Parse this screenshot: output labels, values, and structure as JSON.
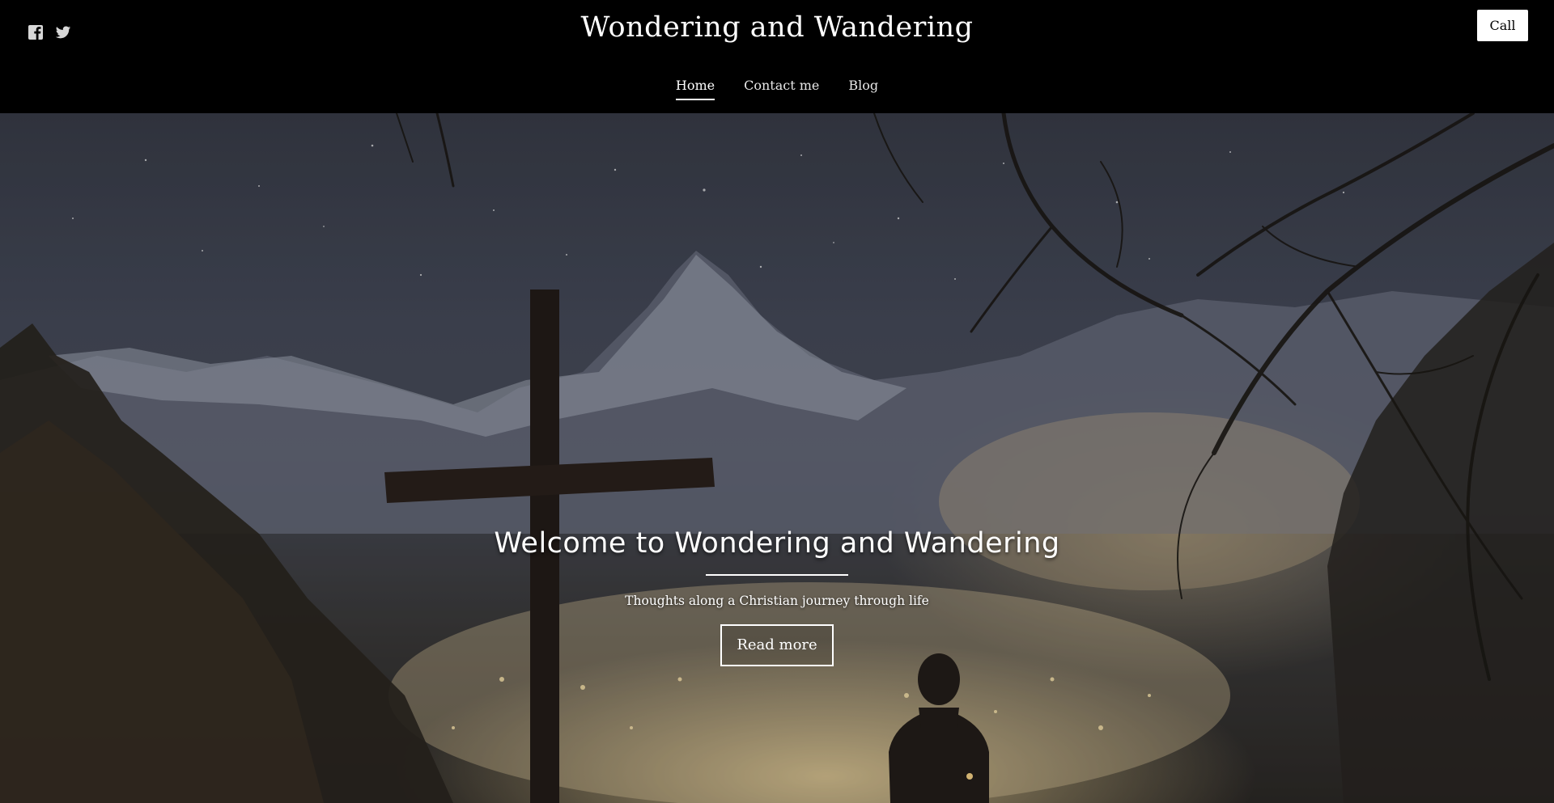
{
  "header": {
    "site_title": "Wondering and Wandering",
    "social": [
      {
        "icon": "facebook-icon"
      },
      {
        "icon": "twitter-icon"
      }
    ],
    "call_label": "Call"
  },
  "nav": {
    "items": [
      {
        "label": "Home",
        "active": true
      },
      {
        "label": "Contact me",
        "active": false
      },
      {
        "label": "Blog",
        "active": false
      }
    ]
  },
  "hero": {
    "title": "Welcome to Wondering and Wandering",
    "subtitle": "Thoughts along a Christian journey through life",
    "button_label": "Read more"
  },
  "colors": {
    "header_background": "#000000",
    "text": "#ffffff",
    "call_button_background": "#ffffff"
  }
}
